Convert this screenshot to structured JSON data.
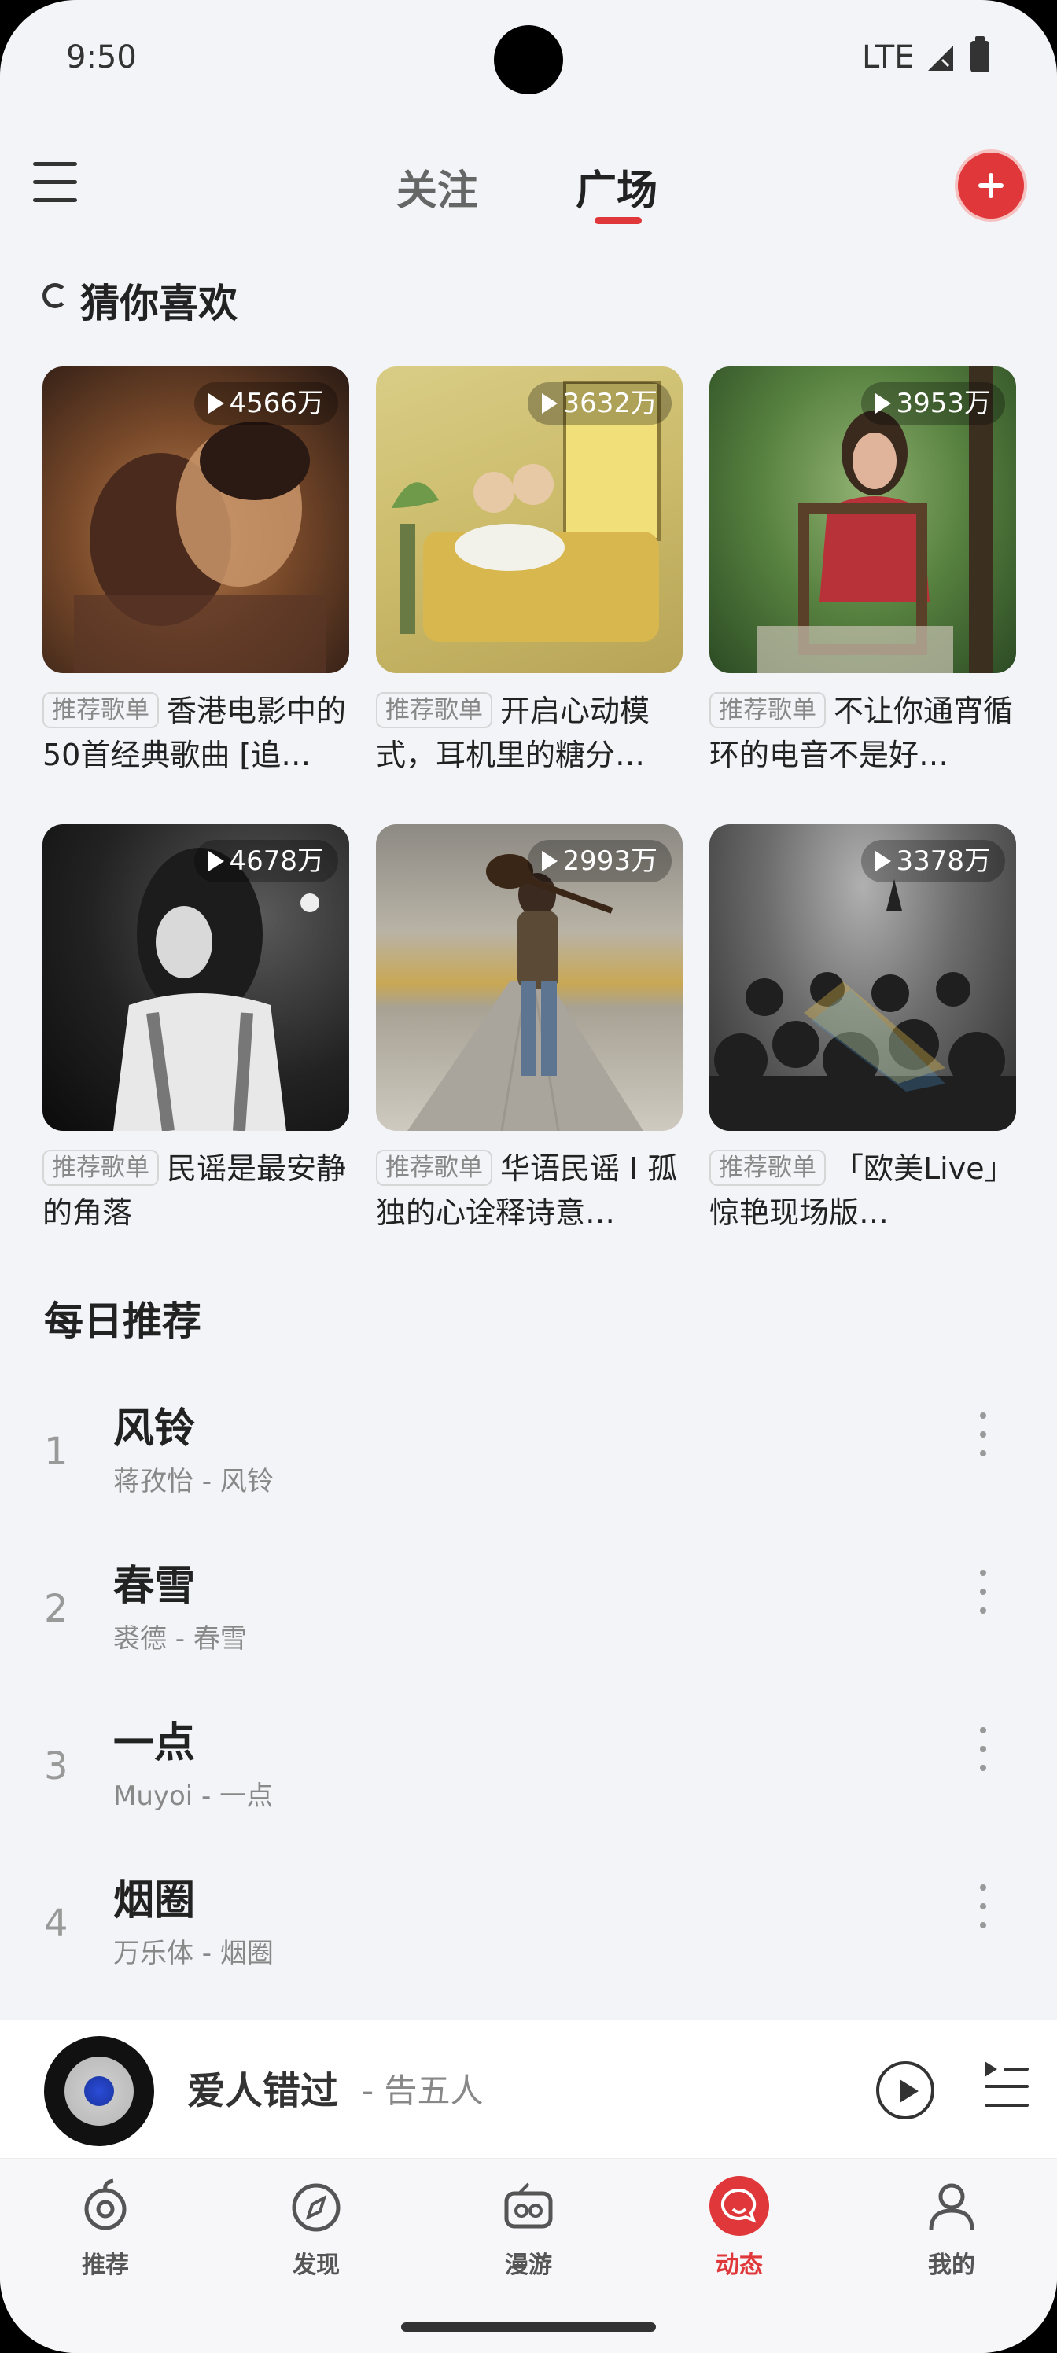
{
  "status": {
    "time": "9:50",
    "network": "LTE"
  },
  "header": {
    "tabs": [
      {
        "label": "关注"
      },
      {
        "label": "广场"
      }
    ],
    "active_tab": "广场",
    "accent": "#e0373a"
  },
  "guess": {
    "title": "猜你喜欢",
    "tag": "推荐歌单",
    "cards": [
      {
        "plays": "4566万",
        "title": "香港电影中的50首经典歌曲 [追…",
        "cover": "warm-film-still"
      },
      {
        "plays": "3632万",
        "title": "开启心动模式，耳机里的糖分…",
        "cover": "illustrated-couple-bed"
      },
      {
        "plays": "3953万",
        "title": "不让你通宵循环的电音不是好…",
        "cover": "girl-on-chair-forest"
      },
      {
        "plays": "4678万",
        "title": "民谣是最安静的角落",
        "cover": "bw-girl-guitar"
      },
      {
        "plays": "2993万",
        "title": "华语民谣 I 孤独的心诠释诗意…",
        "cover": "man-road-guitar"
      },
      {
        "plays": "3378万",
        "title": "「欧美Live」惊艳现场版…",
        "cover": "concert-crowd-rainbow"
      }
    ]
  },
  "daily": {
    "title": "每日推荐",
    "songs": [
      {
        "num": "1",
        "title": "风铃",
        "sub": "蒋孜怡 - 风铃"
      },
      {
        "num": "2",
        "title": "春雪",
        "sub": "裘德 - 春雪"
      },
      {
        "num": "3",
        "title": "一点",
        "sub": "Muyoi - 一点"
      },
      {
        "num": "4",
        "title": "烟圈",
        "sub": "万乐体 - 烟圈"
      }
    ]
  },
  "player": {
    "title": "爱人错过",
    "artist": "- 告五人"
  },
  "nav": [
    {
      "label": "推荐",
      "icon": "recommend-icon"
    },
    {
      "label": "发现",
      "icon": "compass-icon"
    },
    {
      "label": "漫游",
      "icon": "radio-icon"
    },
    {
      "label": "动态",
      "icon": "chat-icon",
      "active": true
    },
    {
      "label": "我的",
      "icon": "person-icon"
    }
  ]
}
